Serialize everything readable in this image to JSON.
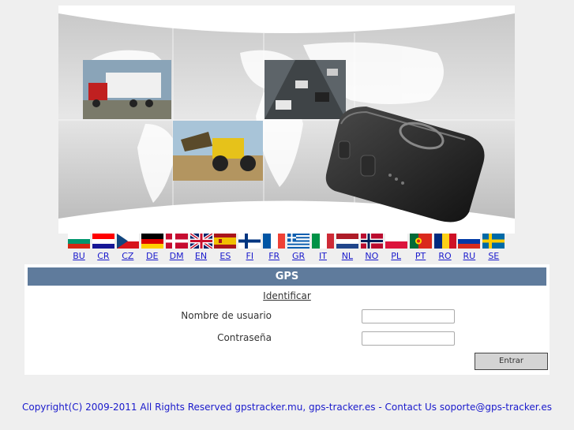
{
  "languages": [
    {
      "code": "BU",
      "colors": [
        "#ffffff",
        "#00966e",
        "#d62612"
      ],
      "flag": "tri-h"
    },
    {
      "code": "CR",
      "colors": [
        "#ff0000",
        "#ffffff",
        "#171796"
      ],
      "flag": "tri-h"
    },
    {
      "code": "CZ",
      "colors": [
        "#ffffff",
        "#d7141a",
        "#11457e"
      ],
      "flag": "cz"
    },
    {
      "code": "DE",
      "colors": [
        "#000000",
        "#dd0000",
        "#ffce00"
      ],
      "flag": "tri-h"
    },
    {
      "code": "DM",
      "colors": [
        "#c60c30",
        "#ffffff"
      ],
      "flag": "nordic"
    },
    {
      "code": "EN",
      "colors": [
        "#012169",
        "#ffffff",
        "#c8102e"
      ],
      "flag": "uk"
    },
    {
      "code": "ES",
      "colors": [
        "#aa151b",
        "#f1bf00",
        "#aa151b"
      ],
      "flag": "es"
    },
    {
      "code": "FI",
      "colors": [
        "#ffffff",
        "#003580"
      ],
      "flag": "nordic"
    },
    {
      "code": "FR",
      "colors": [
        "#0055a4",
        "#ffffff",
        "#ef4135"
      ],
      "flag": "tri-v"
    },
    {
      "code": "GR",
      "colors": [
        "#0d5eaf",
        "#ffffff"
      ],
      "flag": "gr"
    },
    {
      "code": "IT",
      "colors": [
        "#009246",
        "#ffffff",
        "#ce2b37"
      ],
      "flag": "tri-v"
    },
    {
      "code": "NL",
      "colors": [
        "#ae1c28",
        "#ffffff",
        "#21468b"
      ],
      "flag": "tri-h"
    },
    {
      "code": "NO",
      "colors": [
        "#ba0c2f",
        "#ffffff",
        "#00205b"
      ],
      "flag": "no"
    },
    {
      "code": "PL",
      "colors": [
        "#ffffff",
        "#dc143c"
      ],
      "flag": "bi-h"
    },
    {
      "code": "PT",
      "colors": [
        "#046a38",
        "#da291c"
      ],
      "flag": "pt"
    },
    {
      "code": "RO",
      "colors": [
        "#002b7f",
        "#fcd116",
        "#ce1126"
      ],
      "flag": "tri-v"
    },
    {
      "code": "RU",
      "colors": [
        "#ffffff",
        "#0039a6",
        "#d52b1e"
      ],
      "flag": "tri-h"
    },
    {
      "code": "SE",
      "colors": [
        "#006aa7",
        "#fecc00"
      ],
      "flag": "nordic"
    }
  ],
  "panel": {
    "title": "GPS",
    "form_heading": "Identificar",
    "username_label": "Nombre de usuario",
    "username_value": "",
    "password_label": "Contraseña",
    "password_value": "",
    "submit_label": "Entrar"
  },
  "footer": {
    "copyright": "Copyright(C) 2009-2011 All Rights Reserved gpstracker.mu, gps-tracker.es - Contact Us soporte@gps-tracker.es"
  },
  "theme": {
    "panel_header_bg": "#5f7b9c",
    "link_color": "#1a1acc",
    "page_bg": "#efefef"
  }
}
